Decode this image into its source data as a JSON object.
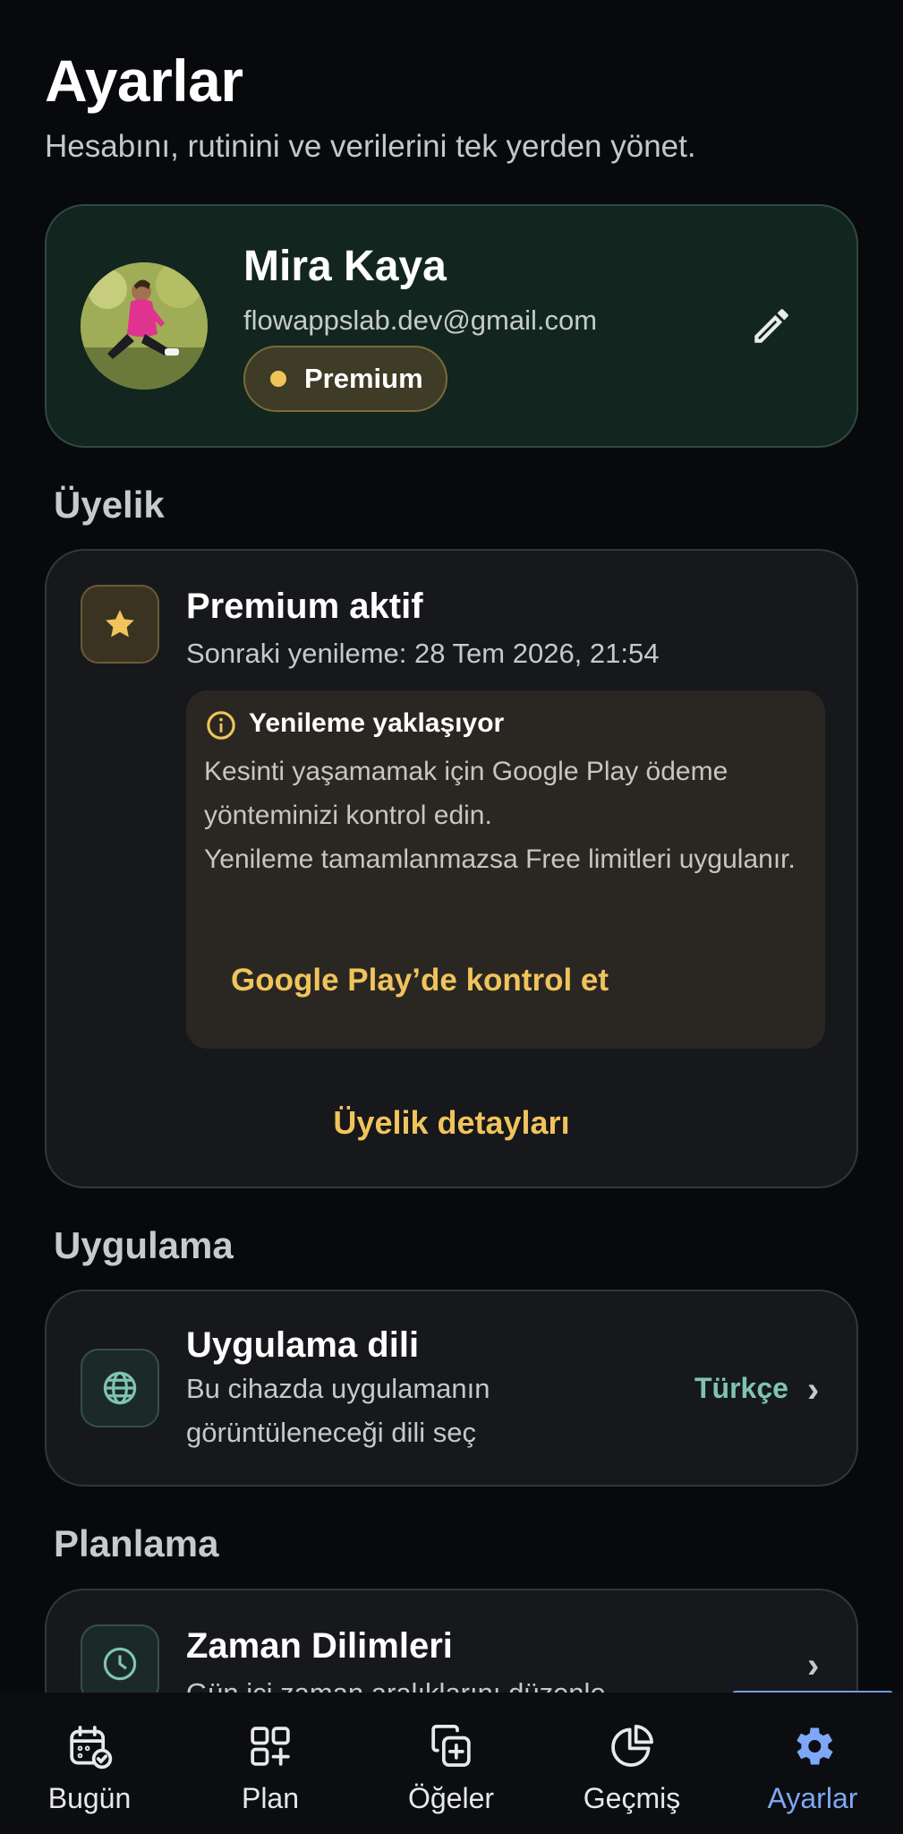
{
  "header": {
    "title": "Ayarlar",
    "subtitle": "Hesabını, rutinini ve verilerini tek yerden yönet."
  },
  "profile": {
    "name": "Mira Kaya",
    "email": "flowappslab.dev@gmail.com",
    "badge": "Premium",
    "edit_icon": "pencil-icon"
  },
  "membership": {
    "section_title": "Üyelik",
    "status_title": "Premium aktif",
    "renewal_text": "Sonraki yenileme: 28 Tem 2026, 21:54",
    "notice": {
      "title": "Yenileme yaklaşıyor",
      "body_line_1": "Kesinti yaşamamak için Google Play ödeme yönteminizi kontrol edin.",
      "body_line_2": "Yenileme tamamlanmazsa Free limitleri uygulanır.",
      "action": "Google Play’de kontrol et"
    },
    "details_link": "Üyelik detayları"
  },
  "app_section": {
    "section_title": "Uygulama",
    "language": {
      "title": "Uygulama dili",
      "description": "Bu cihazda uygulamanın görüntüleneceği dili seç",
      "value": "Türkçe"
    }
  },
  "planning_section": {
    "section_title": "Planlama",
    "time_zones": {
      "title": "Zaman Dilimleri",
      "description": "Gün içi zaman aralıklarını düzenle"
    }
  },
  "bottom_nav": {
    "items": [
      {
        "label": "Bugün",
        "icon": "calendar-check-icon"
      },
      {
        "label": "Plan",
        "icon": "grid-plus-icon"
      },
      {
        "label": "Öğeler",
        "icon": "copy-plus-icon"
      },
      {
        "label": "Geçmiş",
        "icon": "pie-chart-icon"
      },
      {
        "label": "Ayarlar",
        "icon": "gear-icon"
      }
    ],
    "active": "Ayarlar"
  },
  "colors": {
    "background": "#08090c",
    "accent_gold": "#f0c45b",
    "accent_teal": "#7fc4ae",
    "accent_blue": "#7ea8f7",
    "profile_card": "#12261f"
  }
}
